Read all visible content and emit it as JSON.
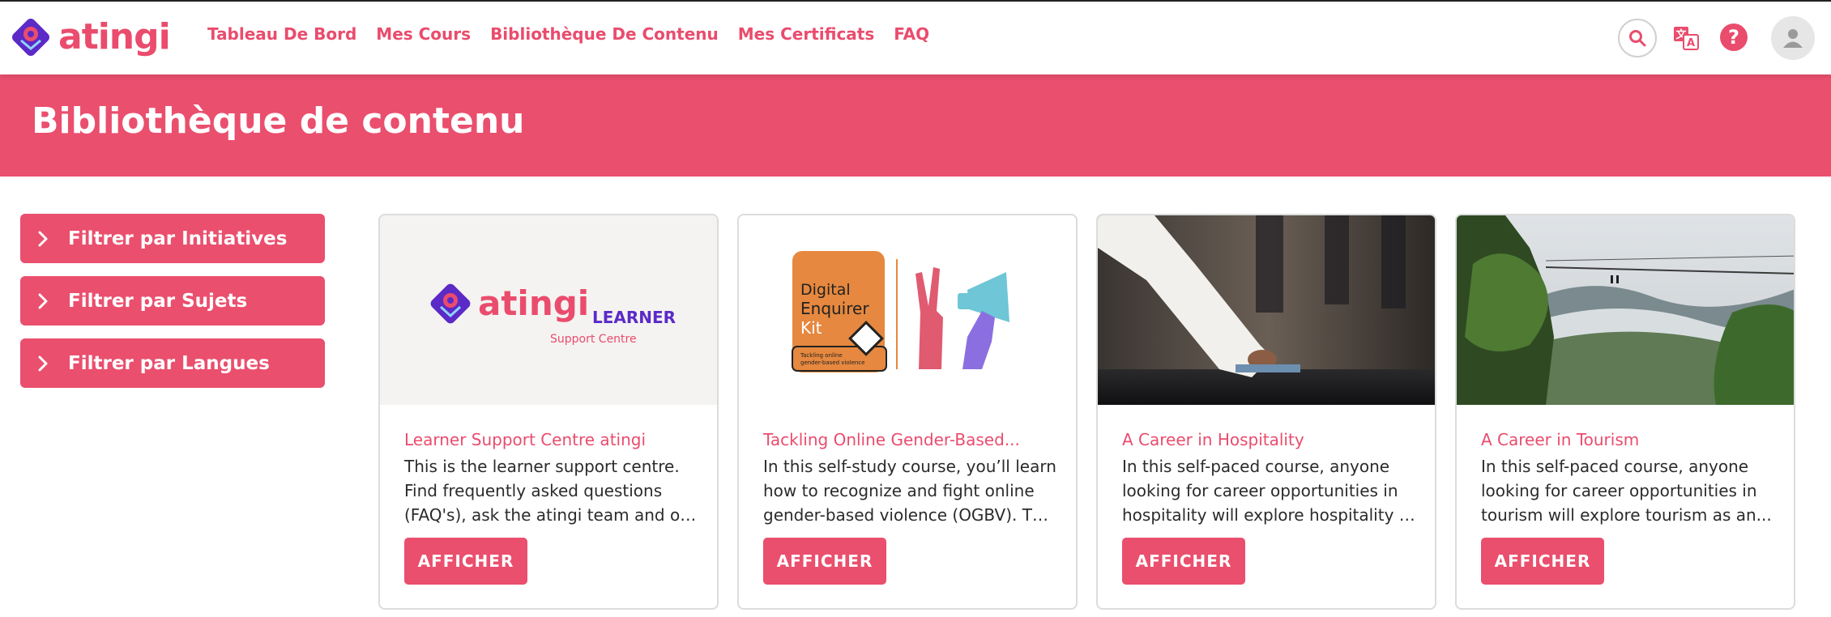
{
  "brand": {
    "name": "atingi",
    "accent": "#ea4f6e",
    "purple": "#5b2ac7"
  },
  "nav": {
    "items": [
      {
        "label": "Tableau De Bord"
      },
      {
        "label": "Mes Cours"
      },
      {
        "label": "Bibliothèque De Contenu"
      },
      {
        "label": "Mes Certificats"
      },
      {
        "label": "FAQ"
      }
    ],
    "icons": [
      "search-icon",
      "translate-icon",
      "help-icon",
      "user-avatar-icon"
    ]
  },
  "page": {
    "title": "Bibliothèque de contenu"
  },
  "filters": [
    {
      "label": "Filtrer par Initiatives",
      "icon": "chevron-right-icon"
    },
    {
      "label": "Filtrer par Sujets",
      "icon": "chevron-right-icon"
    },
    {
      "label": "Filtrer par Langues",
      "icon": "chevron-right-icon"
    }
  ],
  "cards": [
    {
      "title": "Learner Support Centre atingi",
      "desc": [
        "This is the learner support centre.",
        "Find frequently asked questions",
        "(FAQ's), ask the atingi team and oth..."
      ],
      "button": "AFFICHER",
      "image": {
        "brand": "atingi",
        "sub1": "LEARNER",
        "sub2": "Support Centre"
      }
    },
    {
      "title": "Tackling Online Gender-Based...",
      "desc": [
        "In this self-study course, you’ll learn",
        "how to recognize and fight online",
        "gender-based violence (OGBV).  Thi..."
      ],
      "button": "AFFICHER",
      "image": {
        "line1": "Digital",
        "line2": "Enquirer",
        "line3": "Kit",
        "caption1": "Tackling online",
        "caption2": "gender-based violence"
      }
    },
    {
      "title": "A Career in Hospitality",
      "desc": [
        "In this self-paced course, anyone",
        "looking for career opportunities in",
        "hospitality will explore hospitality a..."
      ],
      "button": "AFFICHER",
      "image": {}
    },
    {
      "title": "A Career in Tourism",
      "desc": [
        "In this self-paced course, anyone",
        "looking for career opportunities in",
        "tourism will explore tourism as an..."
      ],
      "button": "AFFICHER",
      "image": {}
    }
  ]
}
